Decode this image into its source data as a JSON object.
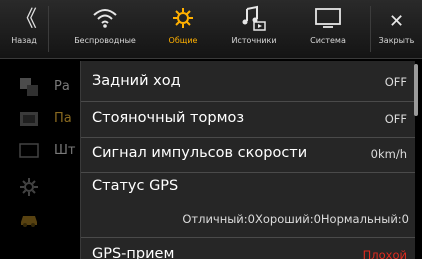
{
  "topbar": {
    "back_label": "Назад",
    "tabs": [
      {
        "label": "Беспроводные",
        "icon": "wifi-icon"
      },
      {
        "label": "Общие",
        "icon": "gear-icon",
        "active": true
      },
      {
        "label": "Источники",
        "icon": "music-source-icon"
      },
      {
        "label": "Система",
        "icon": "monitor-icon"
      }
    ],
    "close_label": "Закрыть",
    "accent_color": "#ffb000"
  },
  "left_panel": {
    "items": [
      {
        "text": "Ра",
        "icon": "language-icon"
      },
      {
        "text": "Па",
        "icon": "film-icon",
        "selected": true
      },
      {
        "text": "Шт",
        "icon": "screen-icon"
      },
      {
        "text": "",
        "icon": "gear-icon"
      },
      {
        "text": "",
        "icon": "car-icon"
      }
    ]
  },
  "popup": {
    "rows": [
      {
        "label": "Задний ход",
        "value": "OFF"
      },
      {
        "label": "Стояночный тормоз",
        "value": "OFF"
      },
      {
        "label": "Сигнал импульсов скорости",
        "value": "0km/h"
      },
      {
        "label": "Статус GPS",
        "value": ""
      },
      {
        "label": "",
        "value": "Отличный:0Хороший:0Нормальный:0"
      },
      {
        "label": "GPS-прием",
        "value": "Плохой"
      }
    ],
    "warn_color": "#e02a1e"
  }
}
